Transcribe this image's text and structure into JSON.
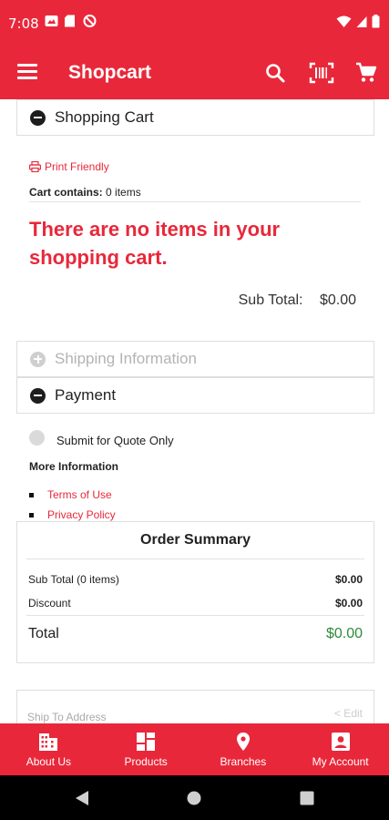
{
  "status_bar": {
    "time": "7:08"
  },
  "app_bar": {
    "title": "Shopcart"
  },
  "sections": {
    "shopping_cart": "Shopping Cart",
    "shipping_information": "Shipping Information",
    "payment": "Payment"
  },
  "cart": {
    "print_friendly": "Print Friendly",
    "contains_label": "Cart contains:",
    "contains_value": "0 items",
    "empty_message": "There are no items in your shopping cart.",
    "subtotal_label": "Sub Total:",
    "subtotal_value": "$0.00"
  },
  "payment": {
    "quote_label": "Submit for Quote Only",
    "quote_selected": false,
    "more_info": "More Information",
    "links": [
      "Terms of Use",
      "Privacy Policy"
    ]
  },
  "order_summary": {
    "title": "Order Summary",
    "subtotal_label": "Sub Total (0 items)",
    "subtotal_value": "$0.00",
    "discount_label": "Discount",
    "discount_value": "$0.00",
    "total_label": "Total",
    "total_value": "$0.00"
  },
  "ship_to": {
    "label": "Ship To Address",
    "edit": "< Edit"
  },
  "bottom_nav": {
    "items": [
      {
        "label": "About Us",
        "icon": "building-icon"
      },
      {
        "label": "Products",
        "icon": "grid-icon"
      },
      {
        "label": "Branches",
        "icon": "map-pin-icon"
      },
      {
        "label": "My Account",
        "icon": "account-icon"
      }
    ]
  },
  "colors": {
    "brand": "#e8283a",
    "total": "#2e8b3a"
  }
}
